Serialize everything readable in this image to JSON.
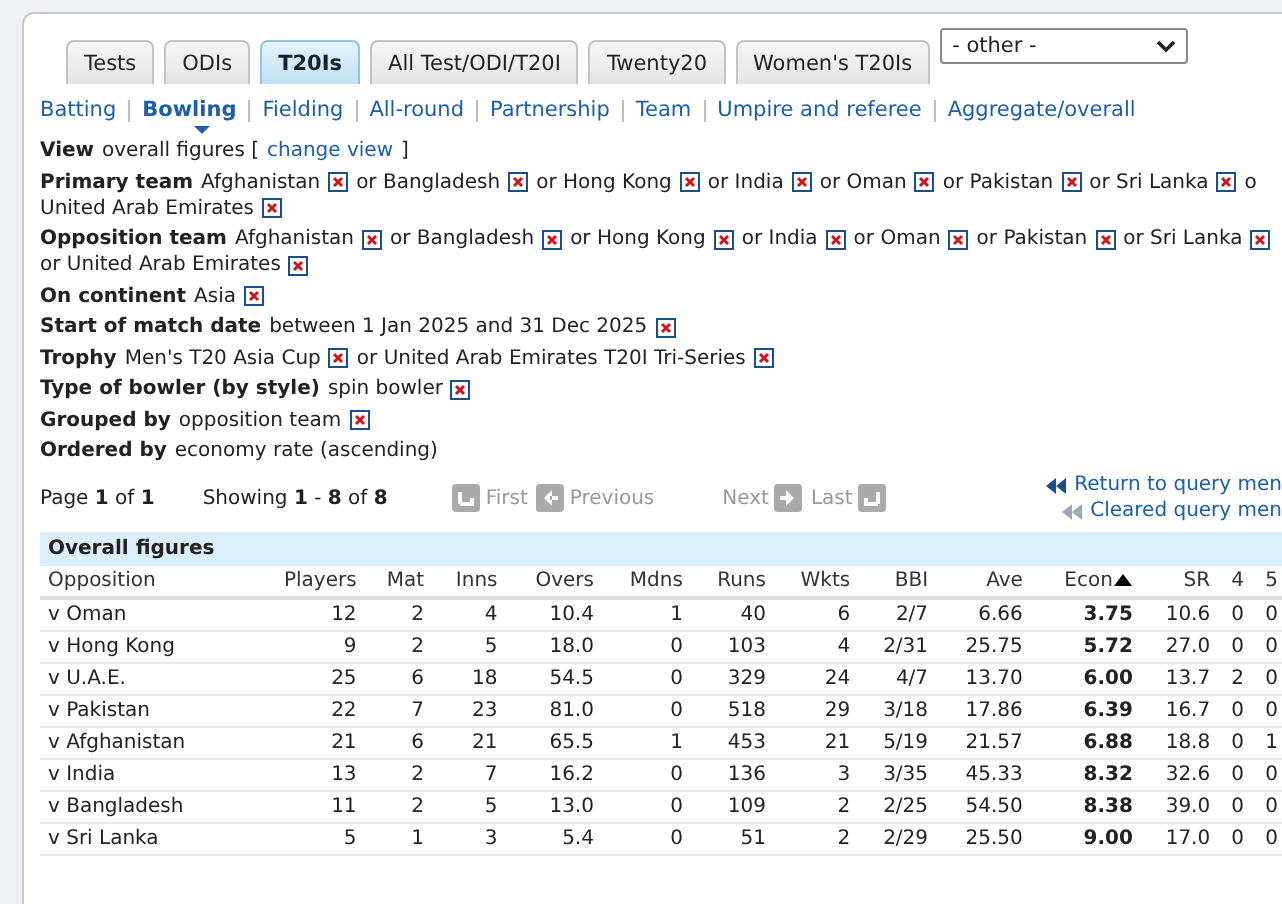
{
  "tabs": [
    {
      "label": "Tests",
      "selected": false
    },
    {
      "label": "ODIs",
      "selected": false
    },
    {
      "label": "T20Is",
      "selected": true
    },
    {
      "label": "All Test/ODI/T20I",
      "selected": false
    },
    {
      "label": "Twenty20",
      "selected": false
    },
    {
      "label": "Women's T20Is",
      "selected": false
    }
  ],
  "other_select": {
    "value": "- other -"
  },
  "subnav": [
    {
      "label": "Batting",
      "selected": false
    },
    {
      "label": "Bowling",
      "selected": true
    },
    {
      "label": "Fielding",
      "selected": false
    },
    {
      "label": "All-round",
      "selected": false
    },
    {
      "label": "Partnership",
      "selected": false
    },
    {
      "label": "Team",
      "selected": false
    },
    {
      "label": "Umpire and referee",
      "selected": false
    },
    {
      "label": "Aggregate/overall",
      "selected": false
    }
  ],
  "view": {
    "label": "View",
    "value": "overall figures [",
    "link": "change view",
    "after": "]"
  },
  "filters": [
    {
      "label": "Primary team",
      "parts": [
        {
          "text": "Afghanistan",
          "removable": true
        },
        {
          "text": "or Bangladesh",
          "removable": true
        },
        {
          "text": "or Hong Kong",
          "removable": true
        },
        {
          "text": "or India",
          "removable": true
        },
        {
          "text": "or Oman",
          "removable": true
        },
        {
          "text": "or Pakistan",
          "removable": true
        },
        {
          "text": "or Sri Lanka",
          "removable": true
        },
        {
          "text": "o",
          "removable": false
        },
        {
          "text": "United Arab Emirates",
          "removable": true
        }
      ]
    },
    {
      "label": "Opposition team",
      "parts": [
        {
          "text": "Afghanistan",
          "removable": true
        },
        {
          "text": "or Bangladesh",
          "removable": true
        },
        {
          "text": "or Hong Kong",
          "removable": true
        },
        {
          "text": "or India",
          "removable": true
        },
        {
          "text": "or Oman",
          "removable": true
        },
        {
          "text": "or Pakistan",
          "removable": true
        },
        {
          "text": "or Sri Lanka",
          "removable": true
        },
        {
          "text": "or United Arab Emirates",
          "removable": true
        }
      ]
    },
    {
      "label": "On continent",
      "parts": [
        {
          "text": "Asia",
          "removable": true
        }
      ]
    },
    {
      "label": "Start of match date",
      "parts": [
        {
          "text": "between 1 Jan 2025 and 31 Dec 2025",
          "removable": true
        }
      ]
    },
    {
      "label": "Trophy",
      "parts": [
        {
          "text": "Men's T20 Asia Cup",
          "removable": true
        },
        {
          "text": "or United Arab Emirates T20I Tri-Series",
          "removable": true
        }
      ]
    },
    {
      "label": "Type of bowler (by style)",
      "parts": [
        {
          "text": "spin bowler",
          "removable": true
        }
      ]
    },
    {
      "label": "Grouped by",
      "parts": [
        {
          "text": "opposition team",
          "removable": true
        }
      ]
    },
    {
      "label": "Ordered by",
      "parts": [
        {
          "text": "economy rate (ascending)",
          "removable": false
        }
      ]
    }
  ],
  "pagination": {
    "page": "Page **1** of **1**",
    "showing": "Showing **1** - **8** of **8**",
    "buttons": [
      {
        "label": "First",
        "kind": "first",
        "disabled": true
      },
      {
        "label": "Previous",
        "kind": "previous",
        "disabled": true
      },
      {
        "label": "Next",
        "kind": "next",
        "disabled": true
      },
      {
        "label": "Last",
        "kind": "last",
        "disabled": true
      }
    ]
  },
  "query_links": [
    {
      "label": "Return to query men",
      "kind": "return"
    },
    {
      "label": "Cleared query men",
      "kind": "cleared"
    }
  ],
  "table": {
    "title": "Overall figures",
    "columns": [
      {
        "label": "Opposition",
        "sorted": false
      },
      {
        "label": "Players",
        "sorted": false
      },
      {
        "label": "Mat",
        "sorted": false
      },
      {
        "label": "Inns",
        "sorted": false
      },
      {
        "label": "Overs",
        "sorted": false
      },
      {
        "label": "Mdns",
        "sorted": false
      },
      {
        "label": "Runs",
        "sorted": false
      },
      {
        "label": "Wkts",
        "sorted": false
      },
      {
        "label": "BBI",
        "sorted": false
      },
      {
        "label": "Ave",
        "sorted": false
      },
      {
        "label": "Econ",
        "sorted": true
      },
      {
        "label": "SR",
        "sorted": false
      },
      {
        "label": "4",
        "sorted": false
      },
      {
        "label": "5",
        "sorted": false
      }
    ],
    "rows": [
      [
        "v Oman",
        "12",
        "2",
        "4",
        "10.4",
        "1",
        "40",
        "6",
        "2/7",
        "6.66",
        "3.75",
        "10.6",
        "0",
        "0"
      ],
      [
        "v Hong Kong",
        "9",
        "2",
        "5",
        "18.0",
        "0",
        "103",
        "4",
        "2/31",
        "25.75",
        "5.72",
        "27.0",
        "0",
        "0"
      ],
      [
        "v U.A.E.",
        "25",
        "6",
        "18",
        "54.5",
        "0",
        "329",
        "24",
        "4/7",
        "13.70",
        "6.00",
        "13.7",
        "2",
        "0"
      ],
      [
        "v Pakistan",
        "22",
        "7",
        "23",
        "81.0",
        "0",
        "518",
        "29",
        "3/18",
        "17.86",
        "6.39",
        "16.7",
        "0",
        "0"
      ],
      [
        "v Afghanistan",
        "21",
        "6",
        "21",
        "65.5",
        "1",
        "453",
        "21",
        "5/19",
        "21.57",
        "6.88",
        "18.8",
        "0",
        "1"
      ],
      [
        "v India",
        "13",
        "2",
        "7",
        "16.2",
        "0",
        "136",
        "3",
        "3/35",
        "45.33",
        "8.32",
        "32.6",
        "0",
        "0"
      ],
      [
        "v Bangladesh",
        "11",
        "2",
        "5",
        "13.0",
        "0",
        "109",
        "2",
        "2/25",
        "54.50",
        "8.38",
        "39.0",
        "0",
        "0"
      ],
      [
        "v Sri Lanka",
        "5",
        "1",
        "3",
        "5.4",
        "0",
        "51",
        "2",
        "2/29",
        "25.50",
        "9.00",
        "17.0",
        "0",
        "0"
      ]
    ]
  }
}
